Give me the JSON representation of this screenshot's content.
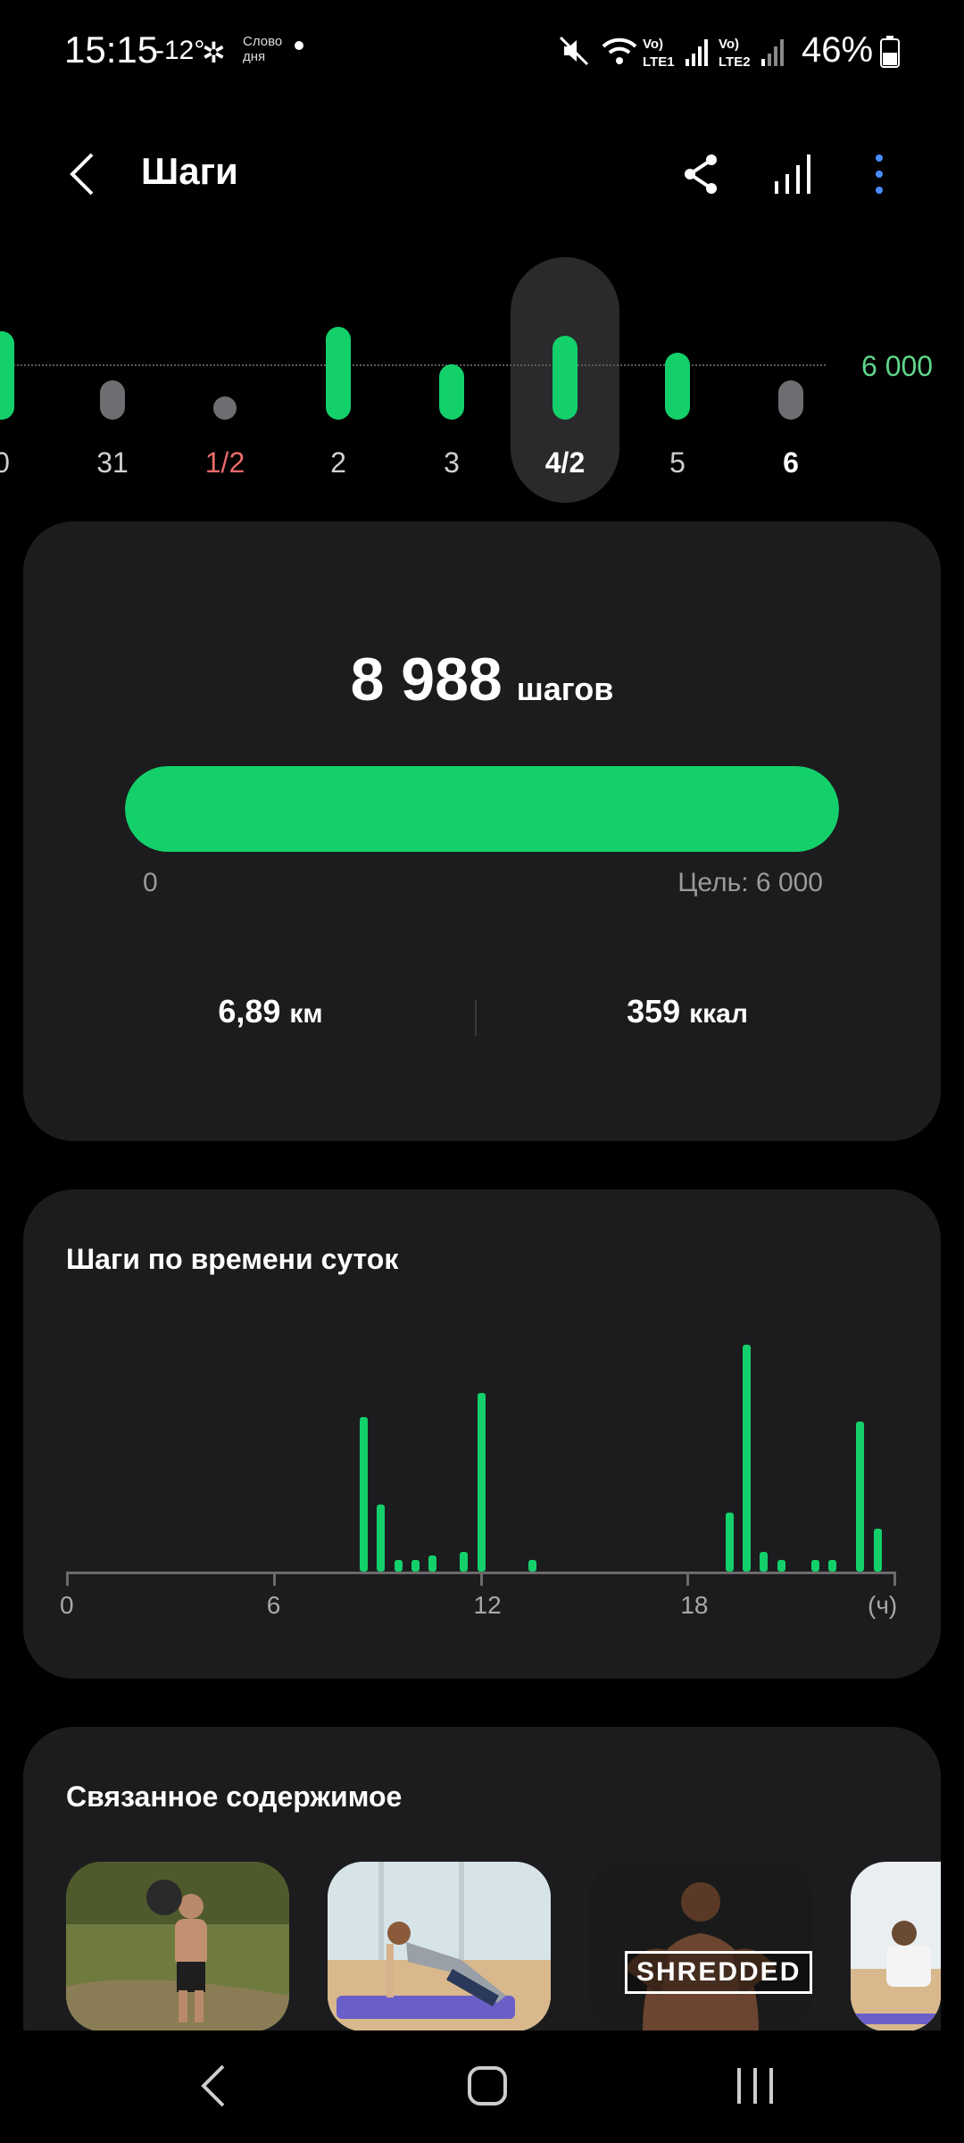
{
  "status_bar": {
    "time": "15:15",
    "temperature": "-12°",
    "word_of_day": "Слово дня",
    "battery": "46%"
  },
  "header": {
    "title": "Шаги"
  },
  "goal_label": "6 000",
  "date_strip": [
    {
      "label": "0",
      "level": 0.95,
      "state": "green"
    },
    {
      "label": "31",
      "level": 0.3,
      "state": "gray"
    },
    {
      "label": "1/2",
      "level": 0.0,
      "state": "dot"
    },
    {
      "label": "2",
      "level": 1.0,
      "state": "green"
    },
    {
      "label": "3",
      "level": 0.6,
      "state": "green"
    },
    {
      "label": "4/2",
      "level": 0.9,
      "state": "green"
    },
    {
      "label": "5",
      "level": 0.72,
      "state": "green"
    },
    {
      "label": "6",
      "level": 0.3,
      "state": "gray"
    }
  ],
  "summary": {
    "steps_value": "8 988",
    "steps_unit": "шагов",
    "progress_fraction": 1.0,
    "min_label": "0",
    "goal_text": "Цель: 6 000",
    "distance_value": "6,89",
    "distance_unit": "км",
    "calories_value": "359",
    "calories_unit": "ккал"
  },
  "hourly": {
    "title": "Шаги по времени суток",
    "axis_labels": [
      "0",
      "6",
      "12",
      "18",
      "(ч)"
    ]
  },
  "chart_data": {
    "type": "bar",
    "x_unit": "ч",
    "xlim": [
      0,
      24
    ],
    "x": [
      8.6,
      9.1,
      9.6,
      10.1,
      10.6,
      11.5,
      12.0,
      13.5,
      19.2,
      19.7,
      20.2,
      20.7,
      21.7,
      22.2,
      23.0,
      23.5
    ],
    "values": [
      108,
      47,
      8,
      8,
      11,
      14,
      125,
      8,
      41,
      159,
      14,
      8,
      8,
      8,
      105,
      30
    ]
  },
  "related": {
    "title": "Связанное содержимое",
    "items": [
      {
        "kind": "workout-outdoor"
      },
      {
        "kind": "workout-mat"
      },
      {
        "kind": "shredded",
        "badge": "SHREDDED"
      },
      {
        "kind": "workout-partial"
      }
    ]
  },
  "colors": {
    "accent": "#13d06b",
    "gray": "#6e6e72",
    "weekend": "#e86a6a"
  }
}
